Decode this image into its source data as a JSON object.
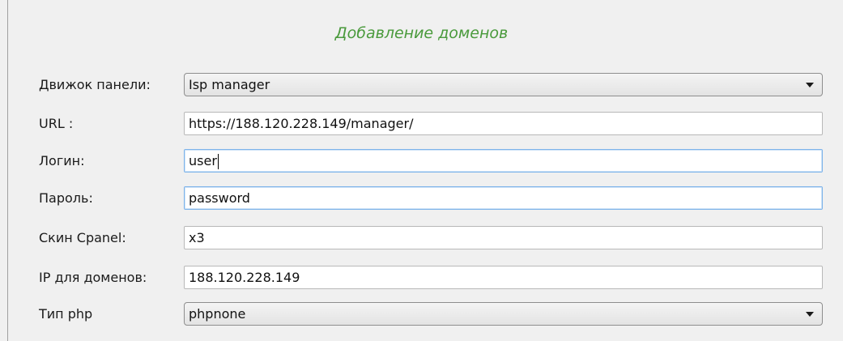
{
  "form": {
    "title": "Добавление доменов",
    "fields": [
      {
        "label": "Движок панели:",
        "value": "Isp manager"
      },
      {
        "label": "URL :",
        "value": "https://188.120.228.149/manager/"
      },
      {
        "label": "Логин:",
        "value": "user"
      },
      {
        "label": "Пароль:",
        "value": "password"
      },
      {
        "label": "Скин Cpanel:",
        "value": "x3"
      },
      {
        "label": "IP для доменов:",
        "value": "188.120.228.149"
      },
      {
        "label": "Тип php",
        "value": "phpnone"
      }
    ]
  },
  "icons": {
    "dropdown": "chevron-down-icon"
  }
}
